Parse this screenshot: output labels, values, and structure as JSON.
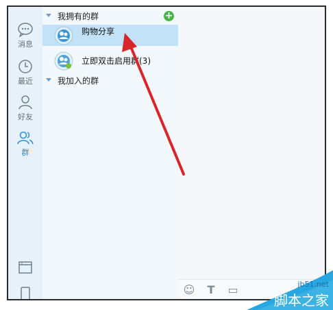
{
  "rail": {
    "items": [
      {
        "label": "消息",
        "icon": "chat-bubble-icon",
        "active": false
      },
      {
        "label": "最近",
        "icon": "clock-icon",
        "active": false
      },
      {
        "label": "好友",
        "icon": "person-icon",
        "active": false
      },
      {
        "label": "群",
        "icon": "group-icon",
        "active": true
      }
    ],
    "bottom_icons": [
      "window-icon",
      "phone-icon"
    ]
  },
  "groups": {
    "owned_header": "我拥有的群",
    "owned_items": [
      {
        "name": "购物分享",
        "selected": true
      },
      {
        "name": "立即双击启用群(3)",
        "selected": false
      }
    ],
    "joined_header": "我加入的群"
  },
  "watermark": {
    "site": "jb51.net",
    "text": "脚本之家"
  },
  "colors": {
    "accent": "#2b8fd6",
    "selected_row": "#c2e2f7",
    "arrow": "#d7262a"
  }
}
